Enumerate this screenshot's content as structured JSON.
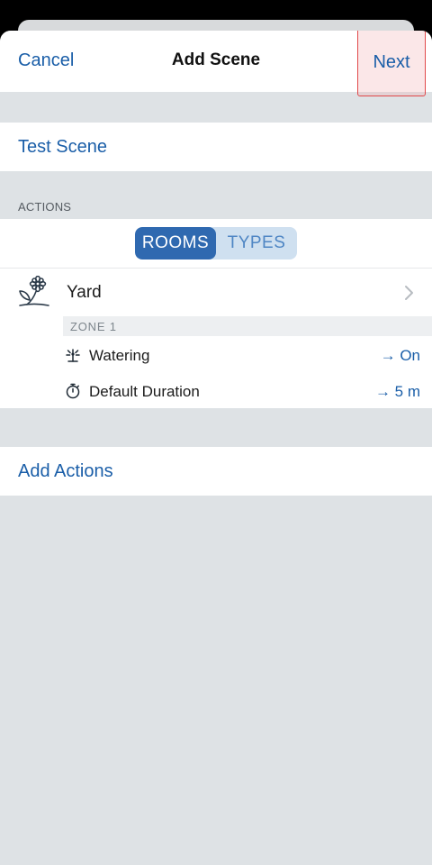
{
  "navbar": {
    "cancel_label": "Cancel",
    "title": "Add Scene",
    "next_label": "Next"
  },
  "scene": {
    "name": "Test Scene"
  },
  "actions": {
    "section_header": "ACTIONS",
    "segments": [
      {
        "label": "ROOMS",
        "selected": true
      },
      {
        "label": "TYPES",
        "selected": false
      }
    ],
    "room": {
      "label": "Yard",
      "icon": "flower-plant-icon",
      "zone_label": "ZONE 1",
      "items": [
        {
          "label": "Watering",
          "value": "→ On",
          "icon": "sprinkler-icon"
        },
        {
          "label": "Default Duration",
          "value": "→ 5 m",
          "icon": "stopwatch-icon"
        }
      ]
    },
    "add_label": "Add Actions"
  },
  "colors": {
    "accent": "#1a5ea8",
    "segment_active": "#2f69b0",
    "background": "#dee2e5",
    "highlight_border": "#e0484a"
  }
}
